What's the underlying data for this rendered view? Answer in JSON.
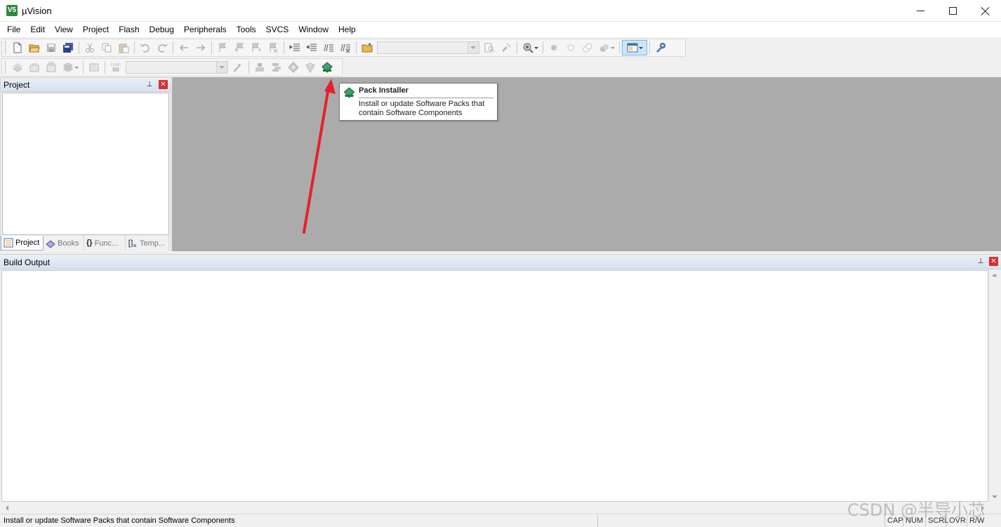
{
  "window": {
    "title": "µVision",
    "logo_text": "V5",
    "controls": {
      "minimize": "minimize-icon",
      "maximize": "maximize-icon",
      "close": "close-icon"
    }
  },
  "menubar": {
    "items": [
      "File",
      "Edit",
      "View",
      "Project",
      "Flash",
      "Debug",
      "Peripherals",
      "Tools",
      "SVCS",
      "Window",
      "Help"
    ]
  },
  "toolbar1": {
    "icons": [
      "new-file-icon",
      "open-folder-icon",
      "save-icon",
      "save-all-icon",
      "cut-icon",
      "copy-icon",
      "paste-icon",
      "undo-icon",
      "redo-icon",
      "nav-back-icon",
      "nav-forward-icon",
      "bookmark-icon",
      "prev-bookmark-icon",
      "next-bookmark-icon",
      "clear-bookmarks-icon",
      "indent-icon",
      "unindent-icon",
      "comment-icon",
      "uncomment-icon",
      "find-in-files-icon",
      "find-icon",
      "incremental-find-icon",
      "debug-session-icon",
      "insert-breakpoint-icon",
      "enable-breakpoint-icon",
      "disable-breakpoints-icon",
      "kill-breakpoints-icon",
      "window-layout-icon",
      "configure-icon"
    ],
    "find_combo_value": ""
  },
  "toolbar2": {
    "icons": [
      "translate-icon",
      "build-icon",
      "rebuild-icon",
      "batch-build-icon",
      "stop-build-icon",
      "download-icon",
      "target-options-icon",
      "manage-components-icon",
      "select-packs-icon",
      "manage-rte-icon",
      "pack-installer-icon"
    ],
    "load_label": "LOAD",
    "target_combo_value": ""
  },
  "project_pane": {
    "title": "Project",
    "pin": "pin-icon",
    "close": "close-icon",
    "tabs": [
      {
        "label": "Project",
        "icon": "project-tab-icon",
        "active": true
      },
      {
        "label": "Books",
        "icon": "books-tab-icon",
        "active": false
      },
      {
        "label": "Func...",
        "icon": "functions-tab-icon",
        "active": false
      },
      {
        "label": "Temp...",
        "icon": "templates-tab-icon",
        "active": false
      }
    ]
  },
  "tooltip": {
    "title": "Pack Installer",
    "body": "Install or update Software Packs that contain Software Components",
    "icon": "pack-installer-icon"
  },
  "build_output": {
    "title": "Build Output",
    "content": ""
  },
  "statusbar": {
    "message": "Install or update Software Packs that contain Software Components",
    "indicators": [
      "CAP",
      "NUM",
      "SCRL",
      "OVR",
      "R/W"
    ]
  },
  "watermark": "CSDN @半导小芯",
  "colors": {
    "editor_background": "#ababab",
    "pane_header": "#dbe5f0",
    "annotation_arrow": "#e8202a",
    "close_button": "#d9302f",
    "active_tool_highlight": "#cde6f7"
  }
}
